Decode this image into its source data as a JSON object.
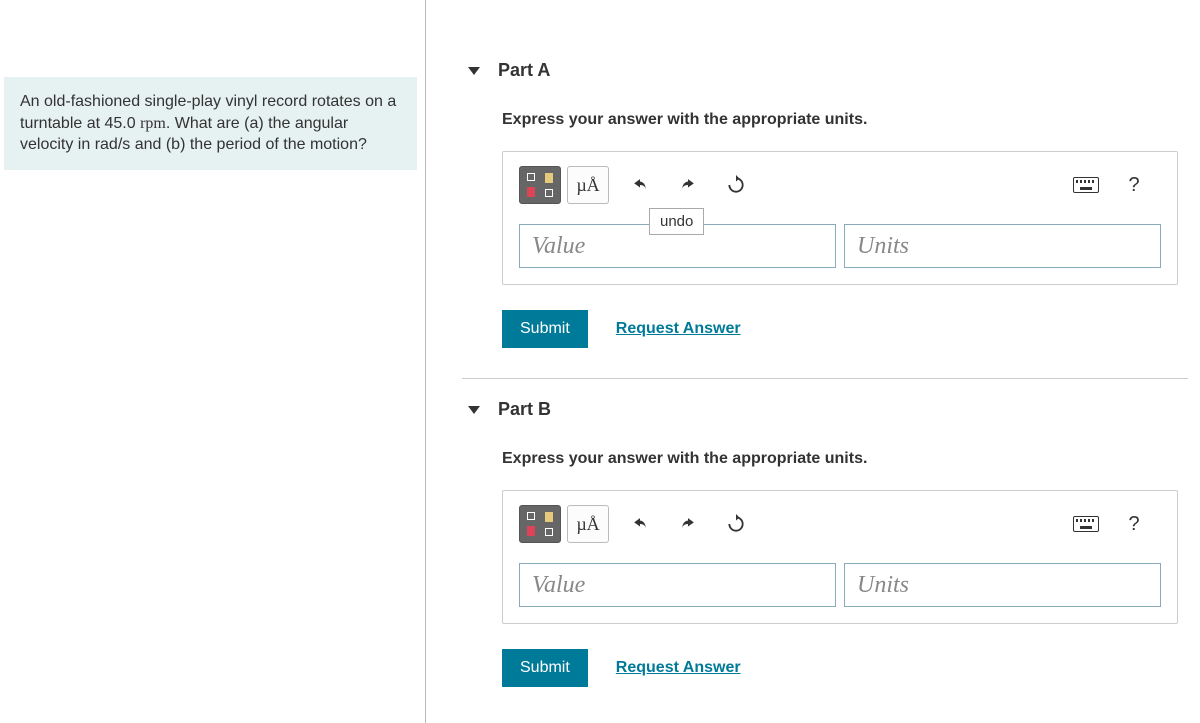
{
  "question": {
    "text_pre": "An old-fashioned single-play vinyl record rotates on a turntable at 45.0 ",
    "rpm": "rpm",
    "text_post": ". What are (a) the angular velocity in rad/s and (b) the period of the motion?"
  },
  "parts": [
    {
      "title": "Part A",
      "instruction": "Express your answer with the appropriate units.",
      "value_placeholder": "Value",
      "units_placeholder": "Units",
      "submit_label": "Submit",
      "request_label": "Request Answer",
      "tooltip": "undo",
      "show_tooltip": true
    },
    {
      "title": "Part B",
      "instruction": "Express your answer with the appropriate units.",
      "value_placeholder": "Value",
      "units_placeholder": "Units",
      "submit_label": "Submit",
      "request_label": "Request Answer",
      "tooltip": "",
      "show_tooltip": false
    }
  ],
  "toolbar": {
    "mu_a": "µÅ",
    "help": "?"
  }
}
